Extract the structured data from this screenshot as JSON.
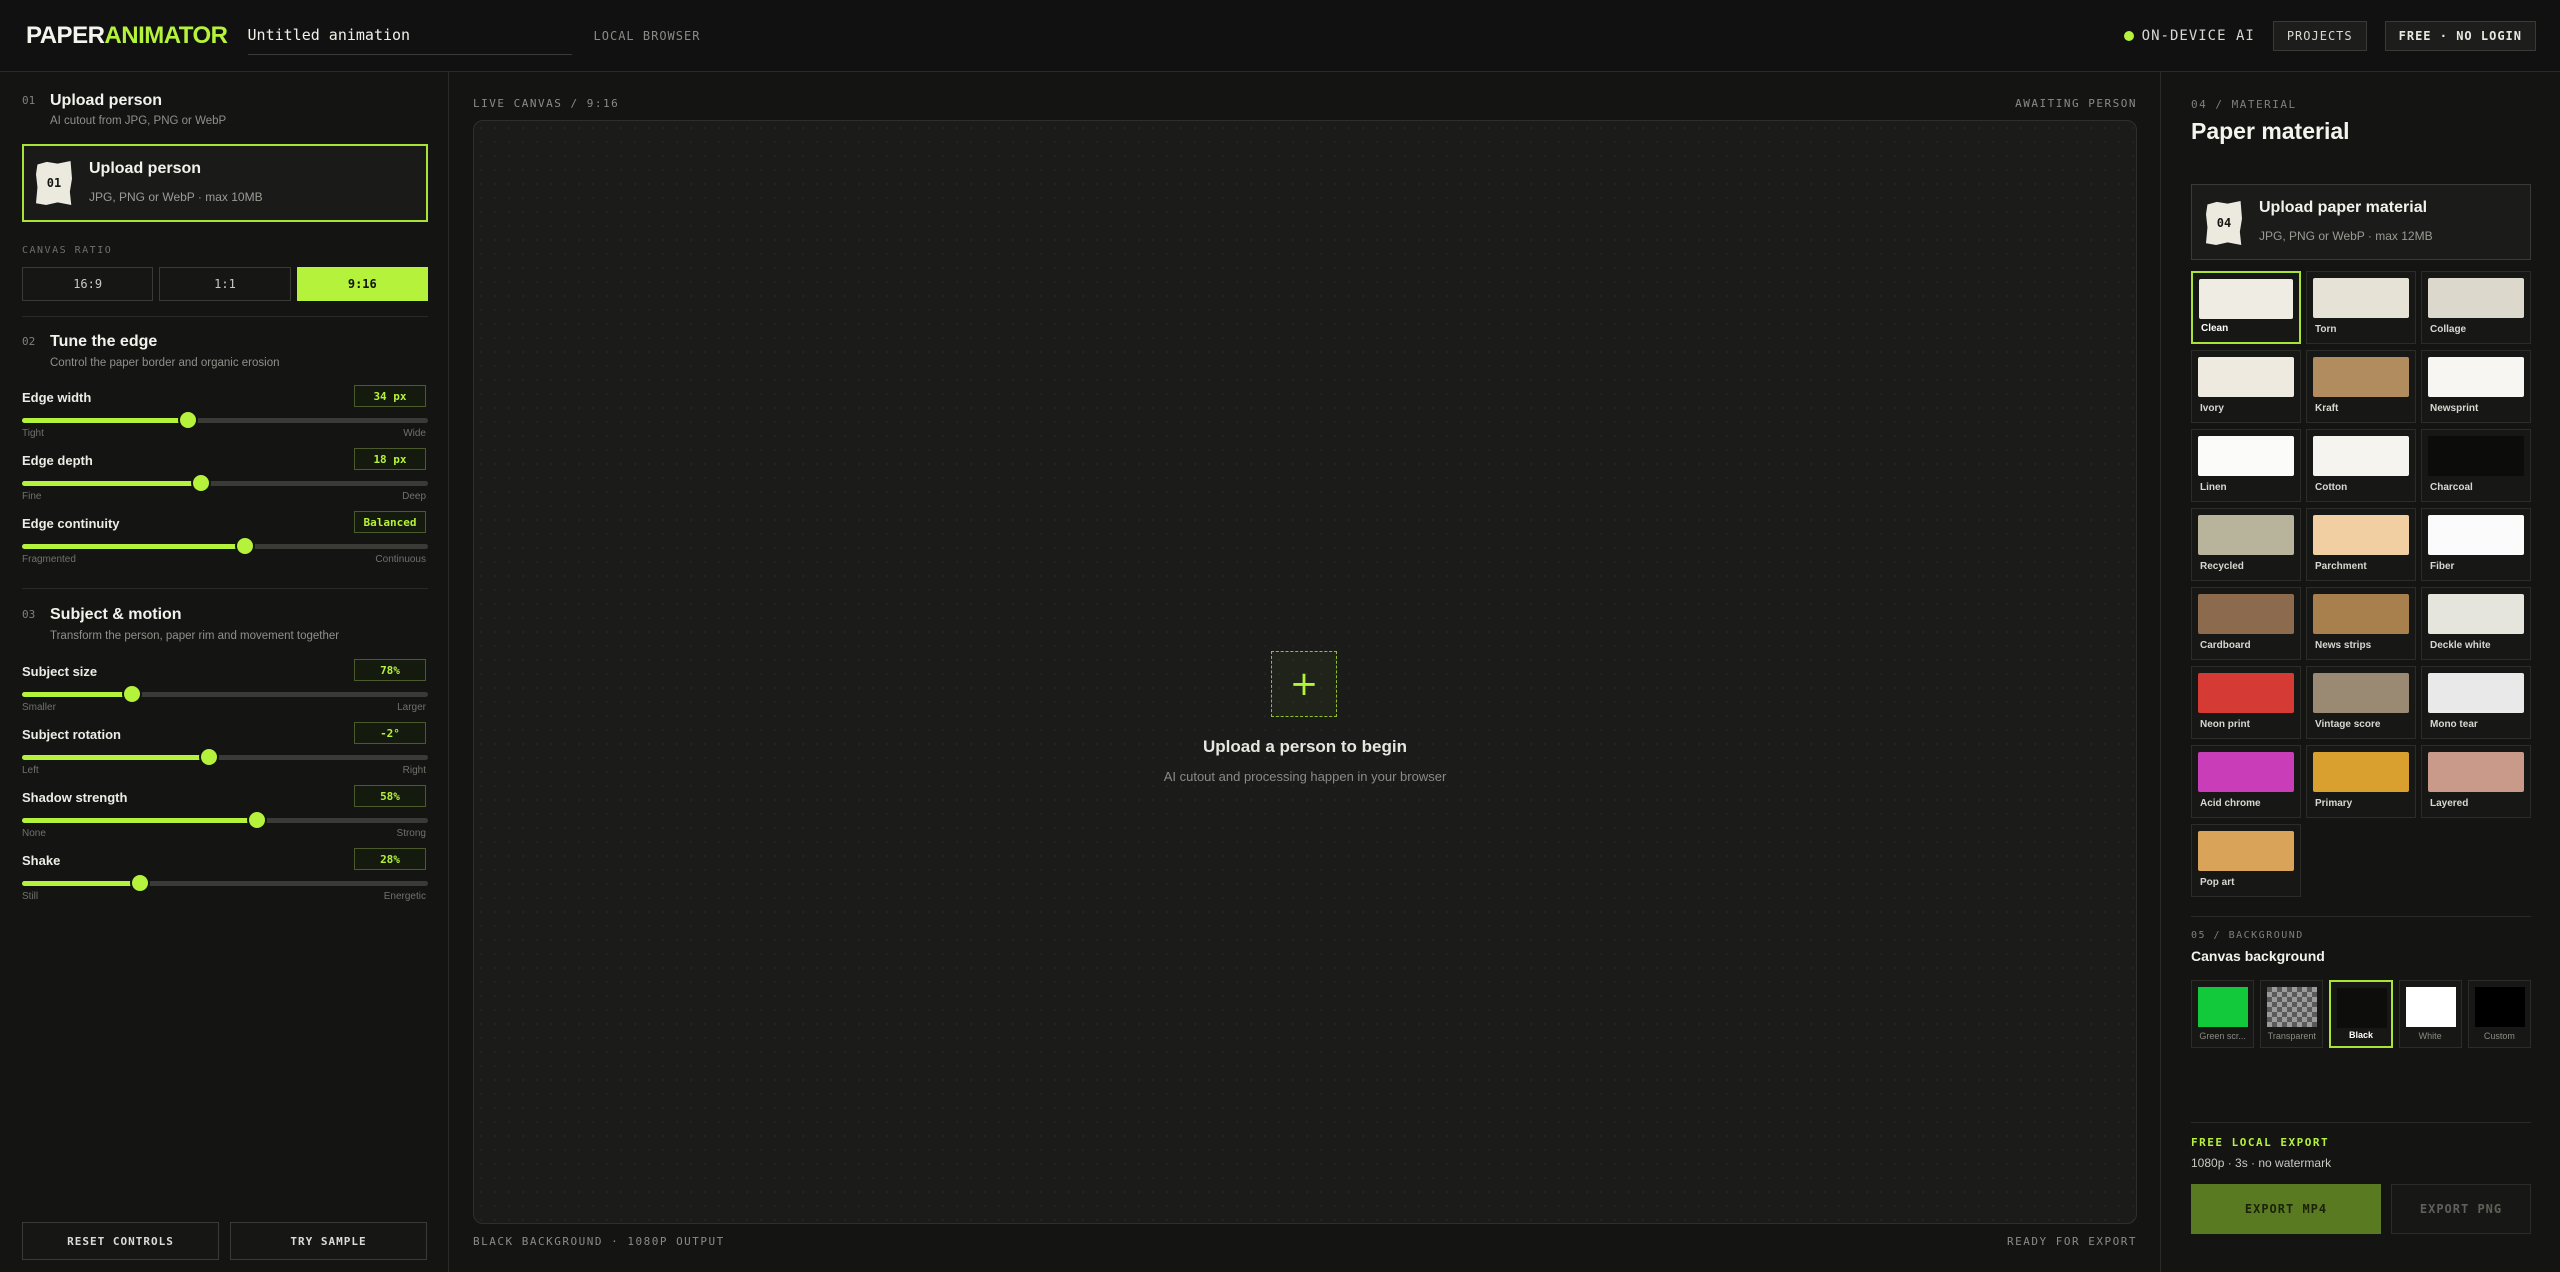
{
  "header": {
    "logo_a": "PAPER",
    "logo_b": "ANIMATOR",
    "doc_title": "Untitled animation",
    "local_tag": "LOCAL BROWSER",
    "ondevice": "ON-DEVICE AI",
    "projects": "PROJECTS",
    "plan": "FREE · NO LOGIN"
  },
  "left": {
    "s1": {
      "num": "01",
      "title": "Upload person",
      "sub": "AI cutout from JPG, PNG or WebP"
    },
    "upload": {
      "badge": "01",
      "title": "Upload person",
      "sub": "JPG, PNG or WebP · max 10MB"
    },
    "ratio_label": "CANVAS RATIO",
    "ratios": [
      "16:9",
      "1:1",
      "9:16"
    ],
    "s2": {
      "num": "02",
      "title": "Tune the edge",
      "sub": "Control the paper border and organic erosion"
    },
    "edge_width": {
      "label": "Edge width",
      "value": "34 px",
      "min": "Tight",
      "max": "Wide",
      "level": 0.41
    },
    "edge_depth": {
      "label": "Edge depth",
      "value": "18 px",
      "min": "Fine",
      "max": "Deep",
      "level": 0.44
    },
    "edge_cont": {
      "label": "Edge continuity",
      "value": "Balanced",
      "min": "Fragmented",
      "max": "Continuous",
      "level": 0.55
    },
    "s3": {
      "num": "03",
      "title": "Subject & motion",
      "sub": "Transform the person, paper rim and movement together"
    },
    "subject_size": {
      "label": "Subject size",
      "value": "78%",
      "min": "Smaller",
      "max": "Larger",
      "level": 0.27
    },
    "subject_rot": {
      "label": "Subject rotation",
      "value": "-2°",
      "min": "Left",
      "max": "Right",
      "level": 0.46
    },
    "shadow": {
      "label": "Shadow strength",
      "value": "58%",
      "min": "None",
      "max": "Strong",
      "level": 0.58
    },
    "shake": {
      "label": "Shake",
      "value": "28%",
      "min": "Still",
      "max": "Energetic",
      "level": 0.29
    },
    "reset": "RESET CONTROLS",
    "sample": "TRY SAMPLE"
  },
  "canvas": {
    "header_left": "LIVE CANVAS / 9:16",
    "header_right": "AWAITING PERSON",
    "plus": "+",
    "title": "Upload a person to begin",
    "sub": "AI cutout and processing happen in your browser",
    "footer_left": "BLACK BACKGROUND · 1080P OUTPUT",
    "footer_right": "READY FOR EXPORT"
  },
  "right": {
    "caps": "04 / MATERIAL",
    "title": "Paper material",
    "upload": {
      "badge": "04",
      "title": "Upload paper material",
      "sub": "JPG, PNG or WebP · max 12MB"
    },
    "materials": [
      {
        "name": "Clean",
        "color": "#efece4"
      },
      {
        "name": "Torn",
        "color": "#e7e2d6"
      },
      {
        "name": "Collage",
        "color": "#dcd8cc"
      },
      {
        "name": "Ivory",
        "color": "#eeeadf"
      },
      {
        "name": "Kraft",
        "color": "#b08c5e"
      },
      {
        "name": "Newsprint",
        "color": "#f7f6f2"
      },
      {
        "name": "Linen",
        "color": "#fbfbf9"
      },
      {
        "name": "Cotton",
        "color": "#f6f4ee"
      },
      {
        "name": "Charcoal",
        "color": "#0c0d0b"
      },
      {
        "name": "Recycled",
        "color": "#b8b49c"
      },
      {
        "name": "Parchment",
        "color": "#f2cfa2"
      },
      {
        "name": "Fiber",
        "color": "#fbfbfb"
      },
      {
        "name": "Cardboard",
        "color": "#8c6a4e"
      },
      {
        "name": "News strips",
        "color": "#a8804e"
      },
      {
        "name": "Deckle white",
        "color": "#e5e5dd"
      },
      {
        "name": "Neon print",
        "color": "#d63a34"
      },
      {
        "name": "Vintage score",
        "color": "#9a8a74"
      },
      {
        "name": "Mono tear",
        "color": "#e9e9e9"
      },
      {
        "name": "Acid chrome",
        "color": "#c93db8"
      },
      {
        "name": "Primary",
        "color": "#d9a030"
      },
      {
        "name": "Layered",
        "color": "#c99a8a"
      },
      {
        "name": "Pop art",
        "color": "#d9a45a"
      }
    ],
    "bg_caps": "05 / BACKGROUND",
    "bg_title": "Canvas background",
    "backgrounds": [
      {
        "name": "Green scr...",
        "color": "#12c93c"
      },
      {
        "name": "Transparent",
        "color": "checker"
      },
      {
        "name": "Black",
        "color": "#0d0e0c"
      },
      {
        "name": "White",
        "color": "#ffffff"
      },
      {
        "name": "Custom",
        "color": "#000000"
      }
    ],
    "export_caps": "FREE LOCAL EXPORT",
    "export_sub": "1080p · 3s · no watermark",
    "export_mp4": "EXPORT MP4",
    "export_png": "EXPORT PNG"
  },
  "colors": {
    "accent": "#b5f23b"
  }
}
